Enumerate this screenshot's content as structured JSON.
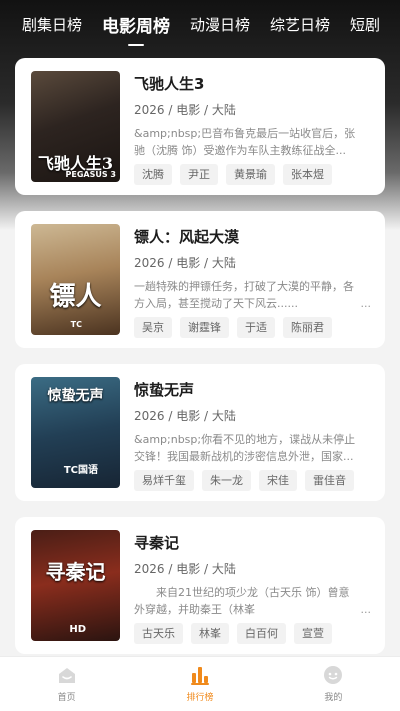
{
  "tabs": [
    {
      "label": "剧集日榜"
    },
    {
      "label": "电影周榜"
    },
    {
      "label": "动漫日榜"
    },
    {
      "label": "综艺日榜"
    },
    {
      "label": "短剧"
    }
  ],
  "movies": [
    {
      "title": "飞驰人生3",
      "meta": "2026 / 电影 / 大陆",
      "desc": "&amp;nbsp;巴音布鲁克最后一站收官后，张驰（沈腾 饰）受邀作为车队主教练征战全...",
      "more": "...",
      "poster_text": "飞驰人生3",
      "poster_badge": "PEGASUS 3",
      "tags": [
        "沈腾",
        "尹正",
        "黄景瑜",
        "张本煜"
      ]
    },
    {
      "title": "镖人：风起大漠",
      "meta": "2026 / 电影 / 大陆",
      "desc": "一趟特殊的押镖任务，打破了大漠的平静，各方入局，甚至搅动了天下风云......",
      "more": "...",
      "poster_text": "镖人",
      "poster_badge": "TC",
      "tags": [
        "吴京",
        "谢霆锋",
        "于适",
        "陈丽君"
      ]
    },
    {
      "title": "惊蛰无声",
      "meta": "2026 / 电影 / 大陆",
      "desc": "&amp;nbsp;你看不见的地方，谍战从未停止交锋！我国最新战机的涉密信息外泄，国家...",
      "more": "...",
      "poster_text": "惊蛰无声",
      "poster_badge": "TC国语",
      "tags": [
        "易烊千玺",
        "朱一龙",
        "宋佳",
        "雷佳音"
      ]
    },
    {
      "title": "寻秦记",
      "meta": "2026 / 电影 / 大陆",
      "desc": "来自21世纪的项少龙（古天乐 饰）曾意外穿越，并助秦王（林峯",
      "more": "...",
      "poster_text": "寻秦记",
      "poster_badge": "HD",
      "tags": [
        "古天乐",
        "林峯",
        "白百何",
        "宣萱"
      ]
    }
  ],
  "nav": [
    {
      "label": "首页",
      "icon": "home-icon"
    },
    {
      "label": "排行榜",
      "icon": "ranking-icon"
    },
    {
      "label": "我的",
      "icon": "profile-icon"
    }
  ],
  "colors": {
    "accent": "#f08a1c",
    "tab_bg": "#121212"
  }
}
